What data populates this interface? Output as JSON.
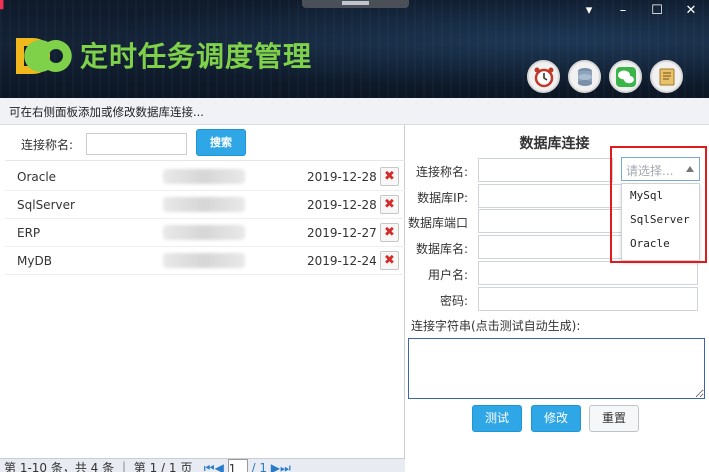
{
  "app": {
    "title": "定时任务调度管理"
  },
  "window": {
    "minimize": "▾",
    "restore": "–",
    "maximize": "☐",
    "close": "✕"
  },
  "header_icons": [
    "alarm-clock-icon",
    "database-icon",
    "wechat-icon",
    "notebook-icon"
  ],
  "tip": "可在右侧面板添加或修改数据库连接...",
  "search": {
    "label": "连接称名:",
    "placeholder": "",
    "button": "搜索"
  },
  "connections": [
    {
      "name": "Oracle",
      "date": "2019-12-28"
    },
    {
      "name": "SqlServer",
      "date": "2019-12-28"
    },
    {
      "name": "ERP",
      "date": "2019-12-27"
    },
    {
      "name": "MyDB",
      "date": "2019-12-24"
    }
  ],
  "pager": {
    "summary": "第 1-10 条，共 4 条 ｜ 第 1 / 1 页",
    "first": "⏮◀",
    "page": "1",
    "total": "/ 1 ▶⏭"
  },
  "form": {
    "title": "数据库连接",
    "fields": {
      "conn_name": "连接称名:",
      "db_ip": "数据库IP:",
      "db_port": "数据库端口",
      "db_name": "数据库名:",
      "user": "用户名:",
      "password": "密码:"
    },
    "type_select": {
      "placeholder": "请选择...",
      "options": [
        "MySql",
        "SqlServer",
        "Oracle"
      ]
    },
    "conn_string_label": "连接字符串(点击测试自动生成):",
    "buttons": {
      "test": "测试",
      "edit": "修改",
      "reset": "重置"
    }
  },
  "colors": {
    "accent": "#2fa6e5",
    "title_green": "#7fd14a",
    "highlight": "#e01b1b",
    "delete_red": "#d42a2a"
  }
}
